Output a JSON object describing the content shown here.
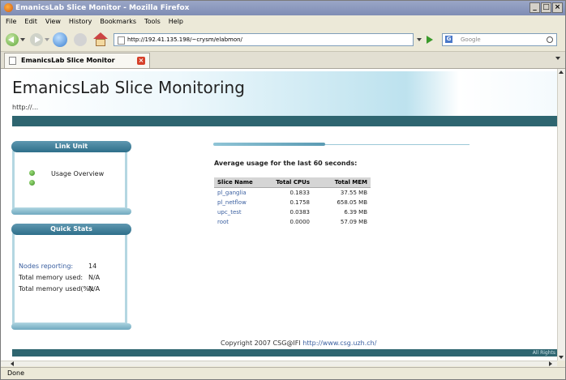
{
  "window": {
    "title": "EmanicsLab Slice Monitor - Mozilla Firefox"
  },
  "menu": [
    "File",
    "Edit",
    "View",
    "History",
    "Bookmarks",
    "Tools",
    "Help"
  ],
  "navbar": {
    "url": "http://192.41.135.198/~crysm/elabmon/",
    "search_placeholder": "Google"
  },
  "tab": {
    "label": "EmanicsLab Slice Monitor"
  },
  "page": {
    "title": "EmanicsLab Slice Monitoring",
    "url_text": "http://...",
    "link_panel": {
      "title": "Link Unit",
      "link": "Usage Overview"
    },
    "stats_panel": {
      "title": "Quick Stats",
      "rows": [
        {
          "label": "Nodes reporting:",
          "value": "14"
        },
        {
          "label": "Total memory used:",
          "value": "N/A"
        },
        {
          "label": "Total memory used(%):",
          "value": "N/A"
        }
      ]
    },
    "usage_heading": "Average usage for the last 60 seconds:",
    "table": {
      "headers": [
        "Slice Name",
        "Total CPUs",
        "Total MEM"
      ],
      "rows": [
        [
          "pl_ganglia",
          "0.1833",
          "37.55 MB"
        ],
        [
          "pl_netflow",
          "0.1758",
          "658.05 MB"
        ],
        [
          "upc_test",
          "0.0383",
          "6.39 MB"
        ],
        [
          "root",
          "0.0000",
          "57.09 MB"
        ]
      ]
    },
    "footer": {
      "copyright": "Copyright 2007 CSG@IFI",
      "link": "http://www.csg.uzh.ch/",
      "rights": "All Rights"
    }
  },
  "status": "Done"
}
